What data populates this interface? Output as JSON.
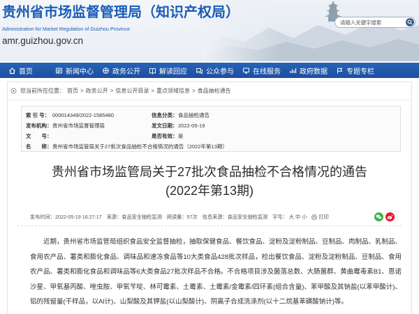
{
  "theme": {
    "brand_blue": "#1b5cb8",
    "nav_blue": "#1d4f9f",
    "wechat_green": "#3fb449",
    "weibo_red": "#e6162d"
  },
  "header": {
    "title": "贵州省市场监督管理局（知识产权局）",
    "subtitle_en": "Administration for Market Regulation of Guizhou Province",
    "domain": "amr.guizhou.gov.cn",
    "landscape_icon": "landscape-image",
    "search": {
      "placeholder": "请输入关键字搜索",
      "icon": "search-icon"
    }
  },
  "nav": [
    {
      "label": "首页",
      "icon": "home-icon"
    },
    {
      "label": "新闻中心",
      "icon": "newspaper-icon"
    },
    {
      "label": "政务公开",
      "icon": "government-icon"
    },
    {
      "label": "解读回应",
      "icon": "book-icon"
    },
    {
      "label": "公众参与",
      "icon": "chat-icon"
    },
    {
      "label": "在线服务",
      "icon": "service-icon"
    },
    {
      "label": "政府数据",
      "icon": "data-chart-icon"
    },
    {
      "label": "专题专栏",
      "icon": "topic-icon"
    }
  ],
  "breadcrumb": {
    "icon": "location-icon",
    "prefix": "您当前所在位置：",
    "separator": ">",
    "items": [
      "首页",
      "政务公开",
      "信息公开目录",
      "重点领域信息",
      "食品抽检通告"
    ]
  },
  "info": {
    "index_label": "索 引 号：",
    "index_value": "000014349/2022-1585480",
    "category_label": "信息分类：",
    "category_value": "食品抽检通告",
    "publisher_label": "发布机构：",
    "publisher_value": "贵州省市场监督管理局",
    "date_label": "发文日期：",
    "date_value": "2022-05-19",
    "docno_label": "文　　号：",
    "docno_value": "",
    "valid_label": "是否有效：",
    "valid_value": "是",
    "name_label": "名　　称：",
    "name_value": "贵州省市场监管局关于27批次食品抽检不合格情况的通告（2022年第13期）"
  },
  "article": {
    "title_line1": "贵州省市场监管局关于27批次食品抽检不合格情况的通告",
    "title_line2": "(2022年第13期)",
    "meta": {
      "publish_time_label": "发布时间：",
      "publish_time": "2022-05-19 16:27:17",
      "source_label": "来源：",
      "source": "食品安全抽检监测",
      "views_label": "阅读量：",
      "views": "57次",
      "info_source_label": "信息来源：",
      "info_source": "食品安全抽检监测",
      "font_size_label": "字号：",
      "font_large": "大",
      "font_medium": "中",
      "font_small": "小",
      "print_label": "打印",
      "print_icon": "printer-icon"
    },
    "share": {
      "wechat_icon": "wechat-icon",
      "weibo_icon": "weibo-icon"
    },
    "body": "近期，贵州省市场监管局组织食品安全监督抽检，抽取保健食品、餐饮食品、淀粉及淀粉制品、豆制品、肉制品、乳制品、食用农产品、薯类和膨化食品、调味品和速冻食品等10大类食品428批次样品，检出餐饮食品、淀粉及淀粉制品、豆制品、食用农产品、薯类和膨化食品和调味品等6大类食品27批次样品不合格。不合格项目涉及菌落总数、大肠菌群、黄曲霉毒素B1、恩诺沙星、甲氧基丙酸、唑虫胺、甲氧苄啶、林可霉素、土霉素、土霉素/金霉素/四环素(组合含量)、苯甲酸及其钠盐(以苯甲酸计)、铝的残留量(干样品，以Al计)、山梨酸及其钾盐(以山梨酸计)、阴离子合成洗涤剂(以十二烷基苯磺酸钠计)等。"
  }
}
